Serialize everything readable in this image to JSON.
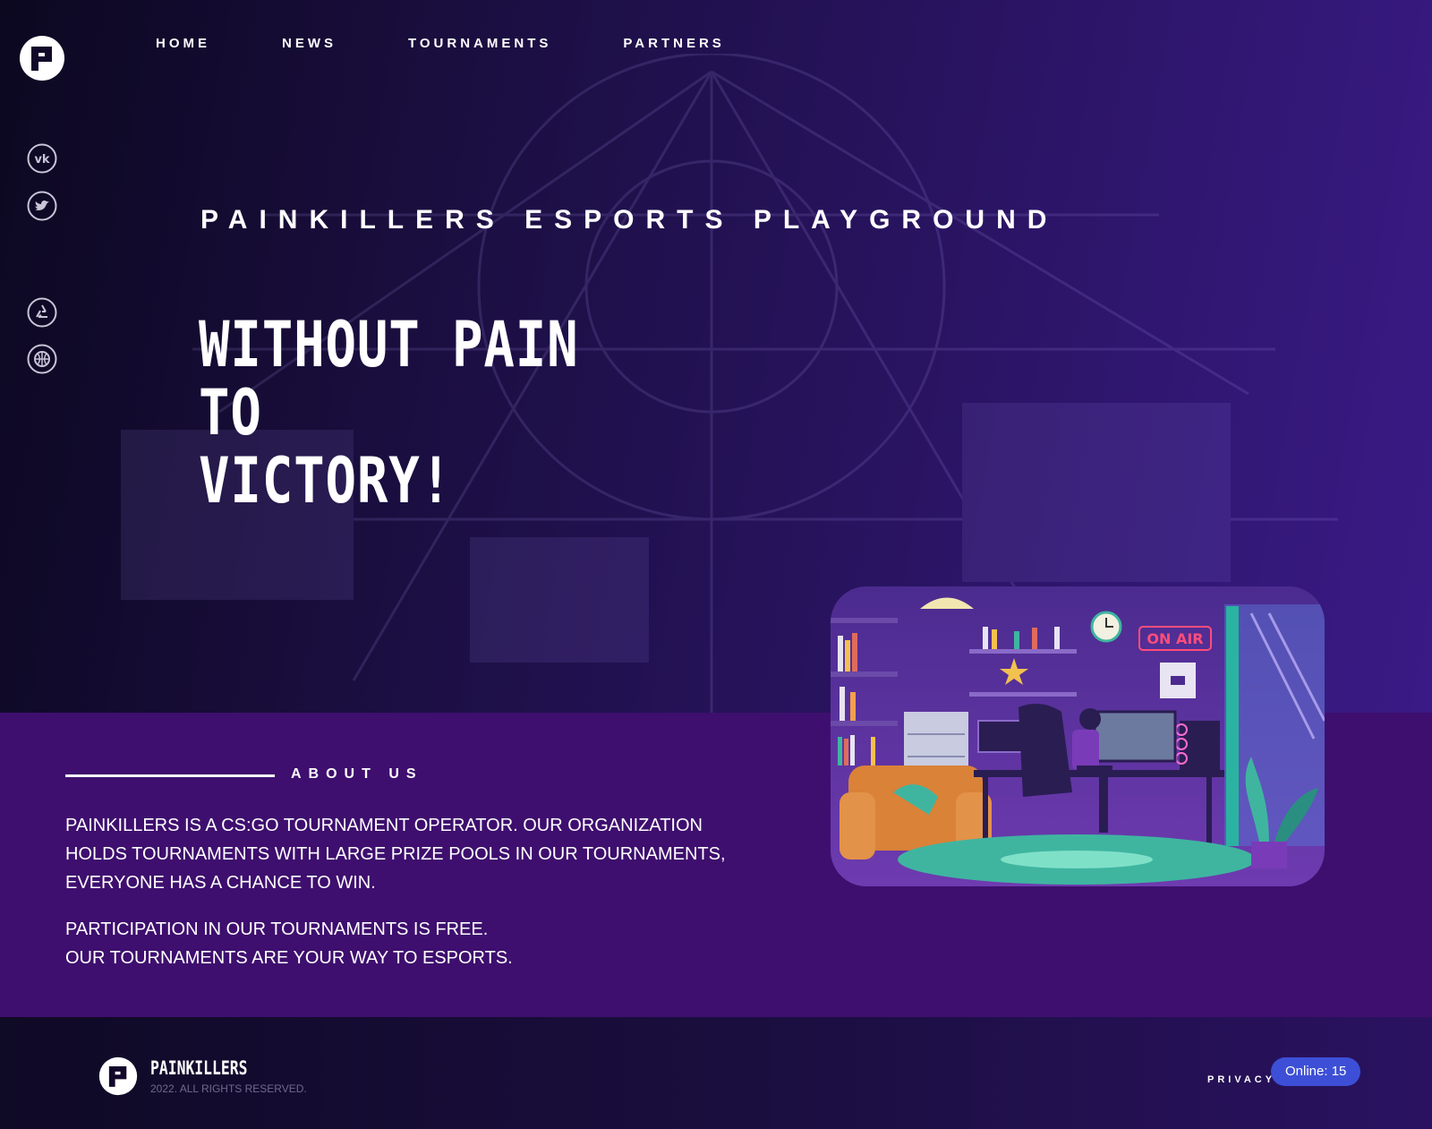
{
  "nav": {
    "items": [
      {
        "label": "HOME"
      },
      {
        "label": "NEWS"
      },
      {
        "label": "TOURNAMENTS"
      },
      {
        "label": "PARTNERS"
      }
    ]
  },
  "sidebar": {
    "icons": [
      "vk-icon",
      "twitter-icon",
      "recycle-icon",
      "basketball-icon"
    ]
  },
  "hero": {
    "tagline": "PAINKILLERS ESPORTS PLAYGROUND",
    "headline_line1": "WITHOUT PAIN TO",
    "headline_line2": "VICTORY!"
  },
  "about": {
    "title": "ABOUT US",
    "paragraph1": "PAINKILLERS IS A CS:GO TOURNAMENT OPERATOR. OUR ORGANIZATION HOLDS TOURNAMENTS WITH LARGE PRIZE POOLS IN OUR TOURNAMENTS, EVERYONE HAS A CHANCE TO WIN.",
    "paragraph2_line1": "PARTICIPATION IN OUR TOURNAMENTS IS FREE.",
    "paragraph2_line2": "OUR TOURNAMENTS ARE YOUR WAY TO ESPORTS.",
    "illustration_sign": "ON AIR"
  },
  "footer": {
    "brand": "PAINKILLERS",
    "copyright": "2022. ALL RIGHTS RESERVED.",
    "privacy": "PRIVACY",
    "online": "Online: 15"
  },
  "colors": {
    "hero_dark": "#0c0820",
    "hero_purple": "#3a1a86",
    "about_bg": "#3e0f6e",
    "online_badge": "#3d4fd6"
  }
}
